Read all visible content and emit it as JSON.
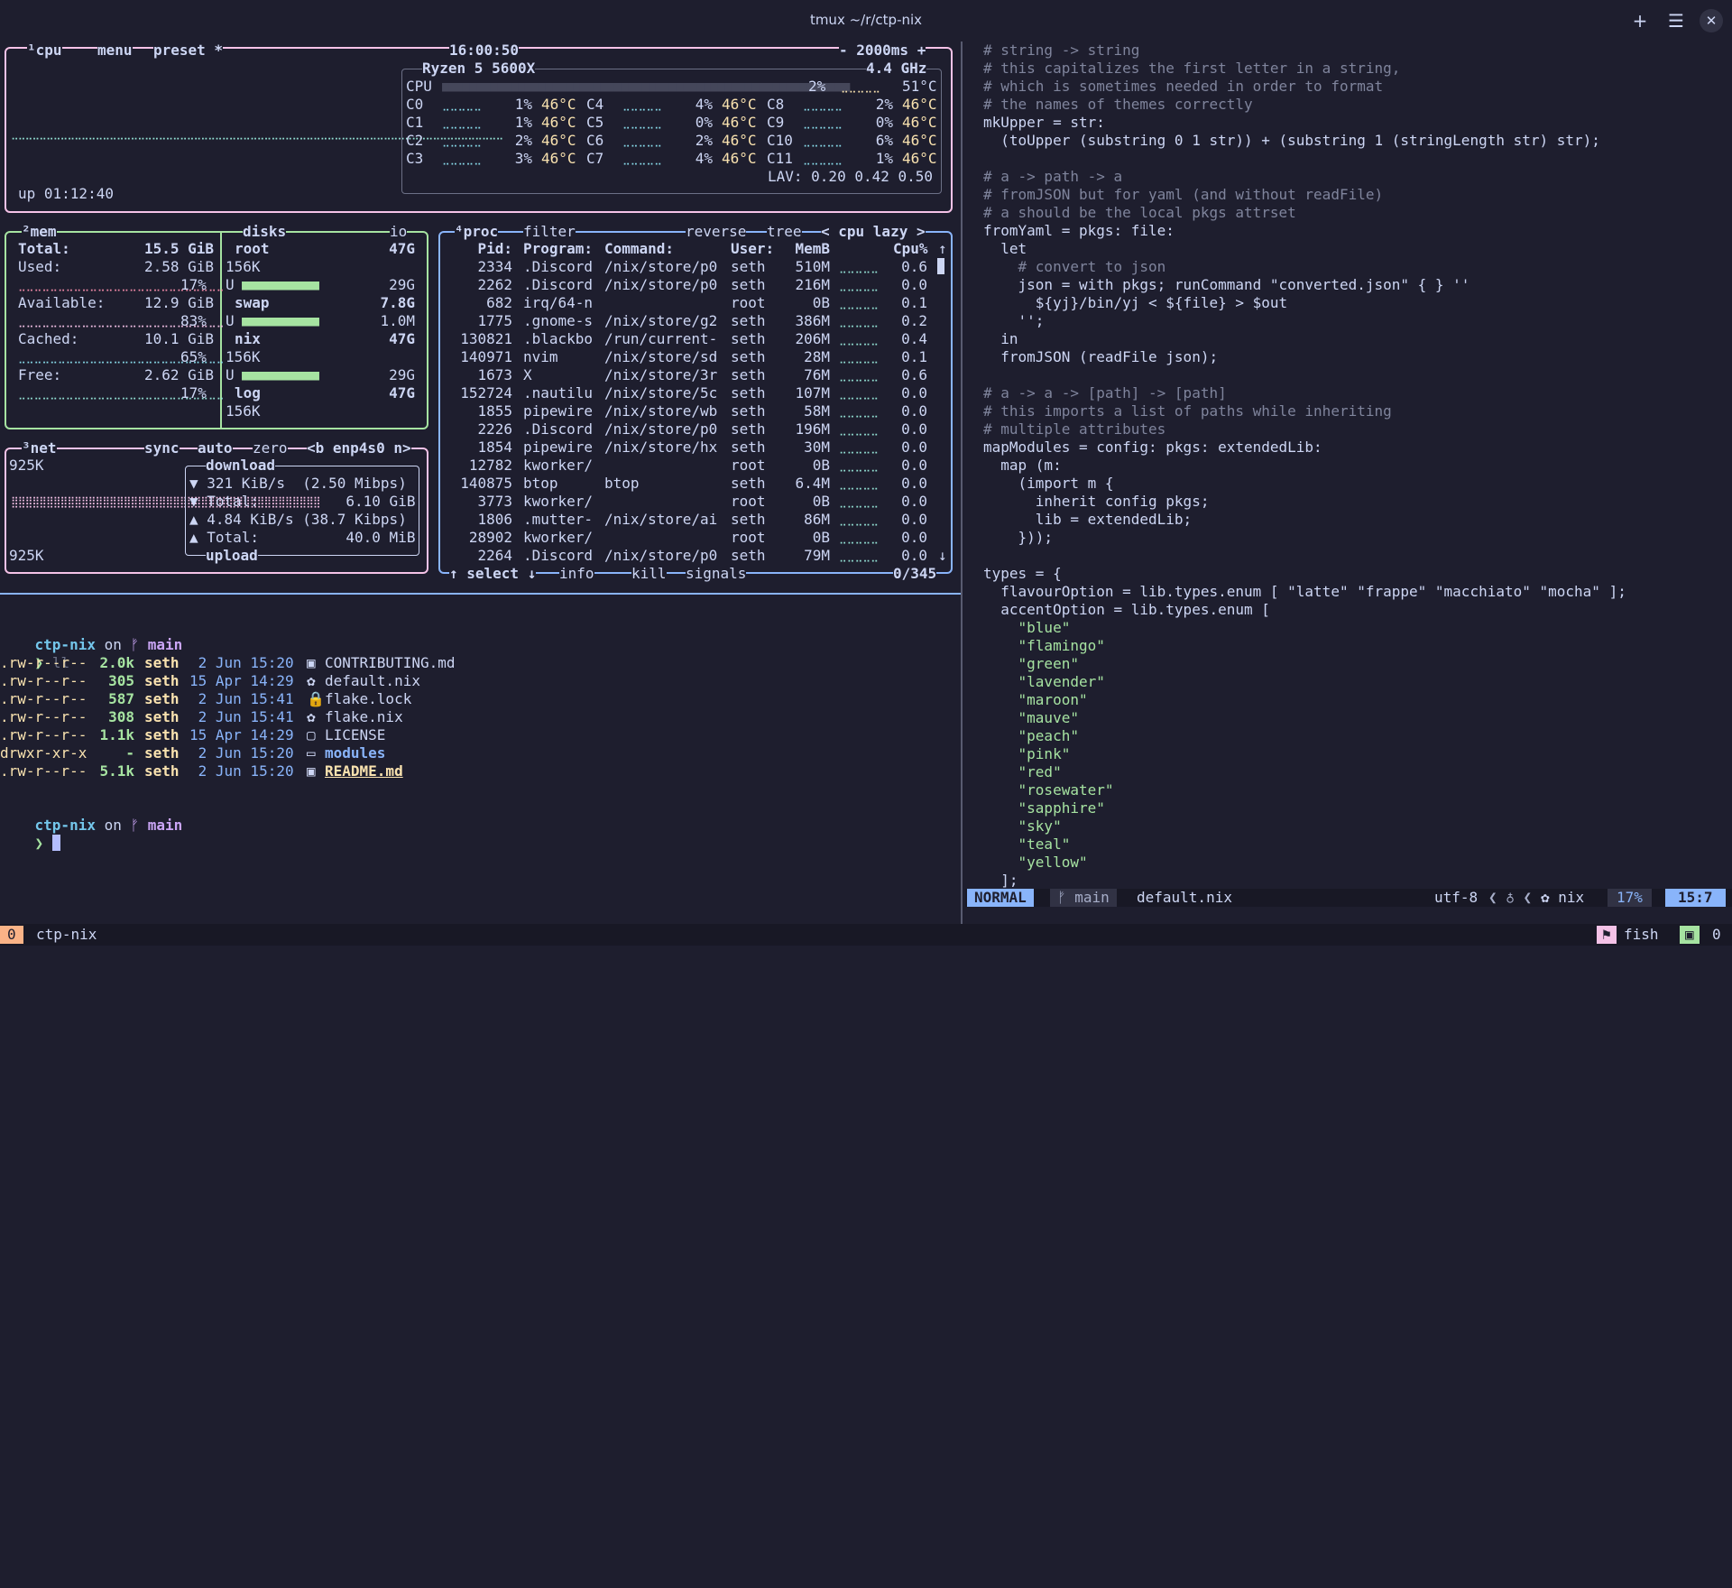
{
  "window": {
    "title": "tmux ~/r/ctp-nix"
  },
  "btop": {
    "cpu_box": {
      "tab_cpu": "¹cpu",
      "tab_menu": "menu",
      "tab_preset": "preset *",
      "clock": "16:00:50",
      "interval": "- 2000ms +",
      "cpu_model": "Ryzen 5 5600X",
      "freq": "4.4 GHz",
      "cpu_total": {
        "label": "CPU",
        "pct": "2%",
        "temp": "51°C"
      },
      "cores": [
        [
          "C0",
          "1%",
          "46°C",
          "C4",
          "4%",
          "46°C",
          "C8",
          "2%",
          "46°C"
        ],
        [
          "C1",
          "1%",
          "46°C",
          "C5",
          "0%",
          "46°C",
          "C9",
          "0%",
          "46°C"
        ],
        [
          "C2",
          "2%",
          "46°C",
          "C6",
          "2%",
          "46°C",
          "C10",
          "6%",
          "46°C"
        ],
        [
          "C3",
          "3%",
          "46°C",
          "C7",
          "4%",
          "46°C",
          "C11",
          "1%",
          "46°C"
        ]
      ],
      "lav": "LAV: 0.20 0.42 0.50",
      "uptime": "up 01:12:40"
    },
    "mem_box": {
      "tab_mem": "²mem",
      "tab_disks": "disks",
      "tab_io": "io",
      "total_label": "Total:",
      "total_val": "15.5 GiB",
      "rows": [
        {
          "label": "Used:",
          "val": "2.58 GiB",
          "pct": "17%"
        },
        {
          "label": "Available:",
          "val": "12.9 GiB",
          "pct": "83%"
        },
        {
          "label": "Cached:",
          "val": "10.1 GiB",
          "pct": "65%"
        },
        {
          "label": "Free:",
          "val": "2.62 GiB",
          "pct": "17%"
        }
      ],
      "disks": [
        {
          "name": "root",
          "size": "47G",
          "io": "156K",
          "used": "29G"
        },
        {
          "name": "swap",
          "size": "7.8G",
          "used": "1.0M"
        },
        {
          "name": "nix",
          "size": "47G",
          "io": "156K",
          "used": "29G"
        },
        {
          "name": "log",
          "size": "47G",
          "io": "156K"
        }
      ]
    },
    "net_box": {
      "tab_net": "³net",
      "tab_sync": "sync",
      "tab_auto": "auto",
      "tab_zero": "zero",
      "iface": "<b enp4s0 n>",
      "scale_top": "925K",
      "scale_bottom": "925K",
      "download_title": "download",
      "upload_title": "upload",
      "down_rate": "▼ 321 KiB/s  (2.50 Mibps)",
      "down_total": "▼ Total:          6.10 GiB",
      "up_rate": "▲ 4.84 KiB/s (38.7 Kibps)",
      "up_total": "▲ Total:          40.0 MiB"
    },
    "proc_box": {
      "tab_proc": "⁴proc",
      "tab_filter": "filter",
      "tab_reverse": "reverse",
      "tab_tree": "tree",
      "sort": "< cpu lazy >",
      "headers": {
        "pid": "Pid:",
        "program": "Program:",
        "command": "Command:",
        "user": "User:",
        "mem": "MemB",
        "cpu": "Cpu%"
      },
      "rows": [
        [
          "2334",
          ".Discord",
          "/nix/store/p0",
          "seth",
          "510M",
          "0.6"
        ],
        [
          "2262",
          ".Discord",
          "/nix/store/p0",
          "seth",
          "216M",
          "0.0"
        ],
        [
          "682",
          "irq/64-n",
          "",
          "root",
          "0B",
          "0.1"
        ],
        [
          "1775",
          ".gnome-s",
          "/nix/store/g2",
          "seth",
          "386M",
          "0.2"
        ],
        [
          "130821",
          ".blackbo",
          "/run/current-",
          "seth",
          "206M",
          "0.4"
        ],
        [
          "140971",
          "nvim",
          "/nix/store/sd",
          "seth",
          "28M",
          "0.1"
        ],
        [
          "1673",
          "X",
          "/nix/store/3r",
          "seth",
          "76M",
          "0.6"
        ],
        [
          "152724",
          ".nautilu",
          "/nix/store/5c",
          "seth",
          "107M",
          "0.0"
        ],
        [
          "1855",
          "pipewire",
          "/nix/store/wb",
          "seth",
          "58M",
          "0.0"
        ],
        [
          "2226",
          ".Discord",
          "/nix/store/p0",
          "seth",
          "196M",
          "0.0"
        ],
        [
          "1854",
          "pipewire",
          "/nix/store/hx",
          "seth",
          "30M",
          "0.0"
        ],
        [
          "12782",
          "kworker/",
          "",
          "root",
          "0B",
          "0.0"
        ],
        [
          "140875",
          "btop",
          "btop",
          "seth",
          "6.4M",
          "0.0"
        ],
        [
          "3773",
          "kworker/",
          "",
          "root",
          "0B",
          "0.0"
        ],
        [
          "1806",
          ".mutter-",
          "/nix/store/ai",
          "seth",
          "86M",
          "0.0"
        ],
        [
          "28902",
          "kworker/",
          "",
          "root",
          "0B",
          "0.0"
        ],
        [
          "2264",
          ".Discord",
          "/nix/store/p0",
          "seth",
          "79M",
          "0.0"
        ]
      ],
      "footer_select": "↑ select ↓",
      "footer_info": "info",
      "footer_kill": "kill",
      "footer_signals": "signals",
      "count": "0/345"
    }
  },
  "shell": {
    "prompt_dir": "ctp-nix",
    "prompt_on": "on",
    "branch_icon": "ᚠ",
    "branch": "main",
    "command": "ll",
    "files": [
      {
        "perm": ".rw-r--r--",
        "size": "2.0k",
        "user": "seth",
        "date": " 2 Jun 15:20",
        "icon": "▣",
        "name": "CONTRIBUTING.md"
      },
      {
        "perm": ".rw-r--r--",
        "size": "305",
        "user": "seth",
        "date": "15 Apr 14:29",
        "icon": "✿",
        "name": "default.nix"
      },
      {
        "perm": ".rw-r--r--",
        "size": "587",
        "user": "seth",
        "date": " 2 Jun 15:41",
        "icon": "🔒",
        "name": "flake.lock"
      },
      {
        "perm": ".rw-r--r--",
        "size": "308",
        "user": "seth",
        "date": " 2 Jun 15:41",
        "icon": "✿",
        "name": "flake.nix"
      },
      {
        "perm": ".rw-r--r--",
        "size": "1.1k",
        "user": "seth",
        "date": "15 Apr 14:29",
        "icon": "▢",
        "name": "LICENSE"
      },
      {
        "perm": "drwxr-xr-x",
        "size": "-",
        "user": "seth",
        "date": " 2 Jun 15:20",
        "icon": "▭",
        "name": "modules"
      },
      {
        "perm": ".rw-r--r--",
        "size": "5.1k",
        "user": "seth",
        "date": " 2 Jun 15:20",
        "icon": "▣",
        "name": "README.md"
      }
    ],
    "prompt_char": "❯"
  },
  "editor": {
    "lines": [
      "# string -> string",
      "# this capitalizes the first letter in a string,",
      "# which is sometimes needed in order to format",
      "# the names of themes correctly",
      "mkUpper = str:",
      "  (toUpper (substring 0 1 str)) + (substring 1 (stringLength str) str);",
      "",
      "# a -> path -> a",
      "# fromJSON but for yaml (and without readFile)",
      "# a should be the local pkgs attrset",
      "fromYaml = pkgs: file:",
      "  let",
      "    # convert to json",
      "    json = with pkgs; runCommand \"converted.json\" { } ''",
      "      ${yj}/bin/yj < ${file} > $out",
      "    '';",
      "  in",
      "  fromJSON (readFile json);",
      "",
      "# a -> a -> [path] -> [path]",
      "# this imports a list of paths while inheriting",
      "# multiple attributes",
      "mapModules = config: pkgs: extendedLib:",
      "  map (m:",
      "    (import m {",
      "      inherit config pkgs;",
      "      lib = extendedLib;",
      "    }));",
      "",
      "types = {",
      "  flavourOption = lib.types.enum [ \"latte\" \"frappe\" \"macchiato\" \"mocha\" ];",
      "  accentOption = lib.types.enum [",
      "    \"blue\"",
      "    \"flamingo\"",
      "    \"green\"",
      "    \"lavender\"",
      "    \"maroon\"",
      "    \"mauve\"",
      "    \"peach\"",
      "    \"pink\"",
      "    \"red\"",
      "    \"rosewater\"",
      "    \"sapphire\"",
      "    \"sky\"",
      "    \"teal\"",
      "    \"yellow\"",
      "  ];"
    ],
    "status": {
      "mode": "NORMAL",
      "branch": "ᚠ main",
      "file": "default.nix",
      "encoding": "utf-8",
      "ft": "✿ nix",
      "percent": "17%",
      "position": "15:7"
    }
  },
  "tmux": {
    "session_index": "0",
    "session_name": "ctp-nix",
    "shell": "fish",
    "win_index": "0"
  }
}
